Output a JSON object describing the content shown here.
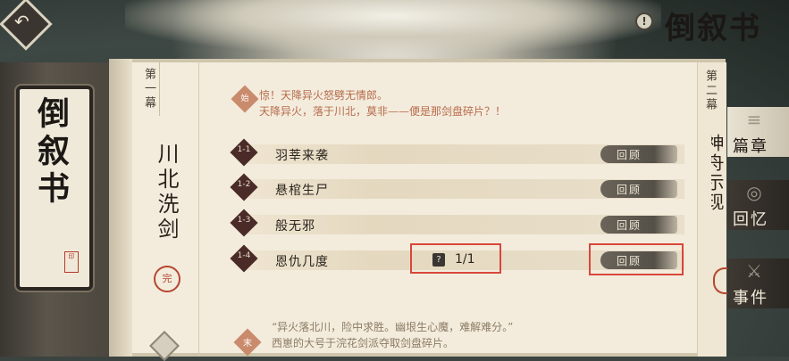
{
  "header": {
    "logo_text": "倒叙书",
    "tip_icon": "!"
  },
  "book": {
    "title": "倒叙书",
    "seal": "印"
  },
  "act1": {
    "label": "第一幕",
    "chapter_name": "川北洗剑",
    "seal_char": "完"
  },
  "intro": {
    "badge": "始",
    "line1": "惊！天降异火怒劈无情郎。",
    "line2": "天降异火，落于川北，莫非——便是那剑盘碎片？！"
  },
  "rows": [
    {
      "id": "1-1",
      "title": "羽莘来袭",
      "review": "回顾"
    },
    {
      "id": "1-2",
      "title": "悬棺生尸",
      "review": "回顾"
    },
    {
      "id": "1-3",
      "title": "般无邪",
      "review": "回顾"
    },
    {
      "id": "1-4",
      "title": "恩仇几度",
      "review": "回顾"
    }
  ],
  "counter": {
    "icon": "?",
    "text": "1/1"
  },
  "ending": {
    "badge": "末",
    "line1": "“异火落北川，险中求胜。幽垠生心魔，难解难分。”",
    "line2": "西崽的大号于浣花剑派夺取剑盘碎片。"
  },
  "act2": {
    "label": "第二幕",
    "name": "神舟示现"
  },
  "side_tabs": [
    {
      "label": "篇章",
      "icon": "≡"
    },
    {
      "label": "回忆",
      "icon": "◎"
    },
    {
      "label": "事件",
      "icon": "⚔"
    }
  ],
  "colors": {
    "highlight": "#d8473a",
    "badge_dark": "#4a2b27",
    "intro_text": "#b76b4b"
  }
}
